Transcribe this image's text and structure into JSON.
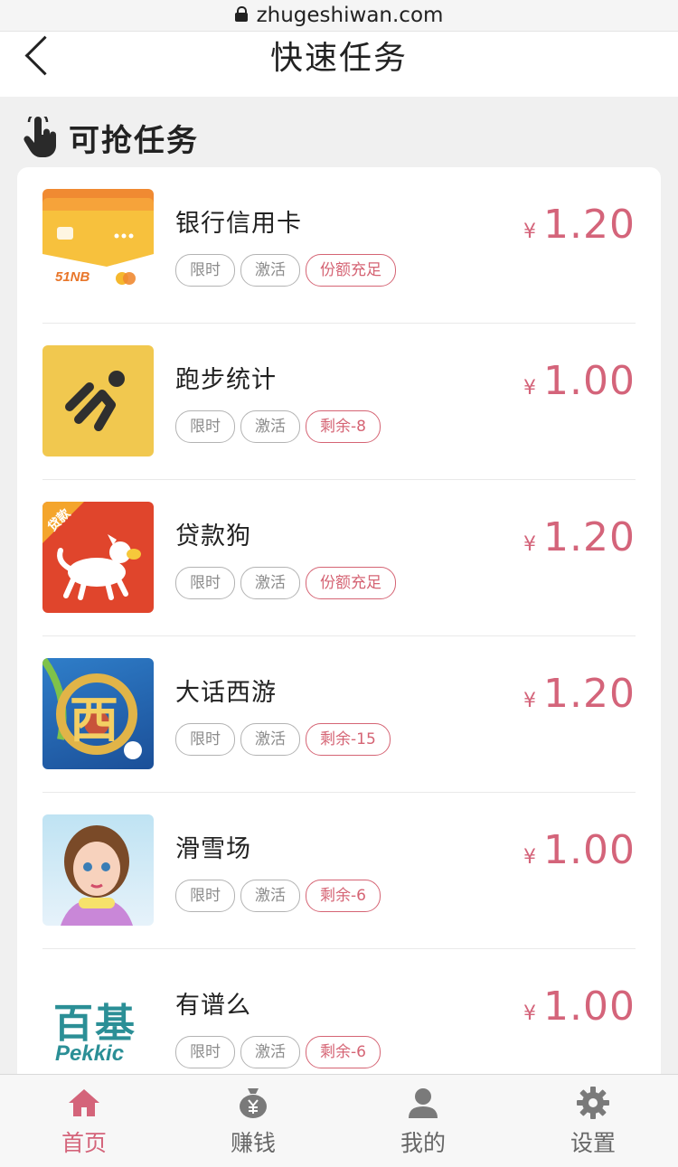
{
  "browser": {
    "url": "zhugeshiwan.com"
  },
  "navbar": {
    "title": "快速任务"
  },
  "section": {
    "title": "可抢任务"
  },
  "tasks": [
    {
      "name": "银行信用卡",
      "tags": [
        "限时",
        "激活",
        "份额充足"
      ],
      "currency": "¥",
      "price": "1.20",
      "icon": "bank-card-icon",
      "icon_text": "51NB"
    },
    {
      "name": "跑步统计",
      "tags": [
        "限时",
        "激活",
        "剩余-8"
      ],
      "currency": "¥",
      "price": "1.00",
      "icon": "running-app-icon"
    },
    {
      "name": "贷款狗",
      "tags": [
        "限时",
        "激活",
        "份额充足"
      ],
      "currency": "¥",
      "price": "1.20",
      "icon": "loan-dog-icon",
      "icon_text": "贷款"
    },
    {
      "name": "大话西游",
      "tags": [
        "限时",
        "激活",
        "剩余-15"
      ],
      "currency": "¥",
      "price": "1.20",
      "icon": "game-xiyou-icon",
      "icon_text": "西"
    },
    {
      "name": "滑雪场",
      "tags": [
        "限时",
        "激活",
        "剩余-6"
      ],
      "currency": "¥",
      "price": "1.00",
      "icon": "ski-girl-icon"
    },
    {
      "name": "有谱么",
      "tags": [
        "限时",
        "激活",
        "剩余-6"
      ],
      "currency": "¥",
      "price": "1.00",
      "icon": "pekkic-logo-icon",
      "icon_text": "百基",
      "icon_subtext": "Pekkic"
    }
  ],
  "tabbar": {
    "items": [
      {
        "label": "首页",
        "icon": "home-icon",
        "active": true
      },
      {
        "label": "赚钱",
        "icon": "money-bag-icon",
        "active": false
      },
      {
        "label": "我的",
        "icon": "user-icon",
        "active": false
      },
      {
        "label": "设置",
        "icon": "gear-icon",
        "active": false
      }
    ]
  },
  "colors": {
    "accent": "#d4647a",
    "tag_border": "#b3b3b3",
    "background": "#f0f0f0"
  }
}
